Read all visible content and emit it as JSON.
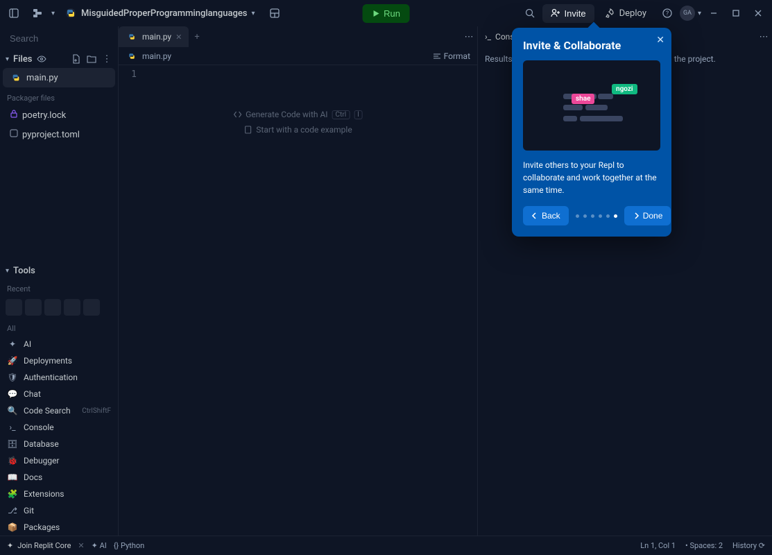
{
  "header": {
    "project_name": "MisguidedProperProgramminglanguages",
    "run": "Run",
    "invite": "Invite",
    "deploy": "Deploy",
    "avatar": "GA"
  },
  "sidebar": {
    "search_placeholder": "Search",
    "files_label": "Files",
    "files": [
      {
        "name": "main.py"
      }
    ],
    "packager_label": "Packager files",
    "packager_files": [
      {
        "name": "poetry.lock"
      },
      {
        "name": "pyproject.toml"
      }
    ],
    "tools_label": "Tools",
    "recent_label": "Recent",
    "all_label": "All",
    "tools": [
      {
        "name": "AI"
      },
      {
        "name": "Deployments"
      },
      {
        "name": "Authentication"
      },
      {
        "name": "Chat"
      },
      {
        "name": "Code Search",
        "shortcut": "CtrlShiftF"
      },
      {
        "name": "Console"
      },
      {
        "name": "Database"
      },
      {
        "name": "Debugger"
      },
      {
        "name": "Docs"
      },
      {
        "name": "Extensions"
      },
      {
        "name": "Git"
      },
      {
        "name": "Packages"
      }
    ]
  },
  "editor": {
    "tab_name": "main.py",
    "crumb": "main.py",
    "format": "Format",
    "line_number": "1",
    "hint_ai": "Generate Code with AI",
    "hint_ai_kbd1": "Ctrl",
    "hint_ai_kbd2": "I",
    "hint_example": "Start with a code example"
  },
  "console": {
    "tab": "Console",
    "placeholder": "Results of your code will appear here when you run the project."
  },
  "statusbar": {
    "join": "Join Replit Core",
    "ai": "AI",
    "lang": "Python",
    "pos": "Ln 1, Col 1",
    "spaces": "Spaces: 2",
    "history": "History"
  },
  "popover": {
    "title": "Invite & Collaborate",
    "tag1": "ngozi",
    "tag2": "shae",
    "desc": "Invite others to your Repl to collaborate and work together at the same time.",
    "back": "Back",
    "done": "Done"
  }
}
